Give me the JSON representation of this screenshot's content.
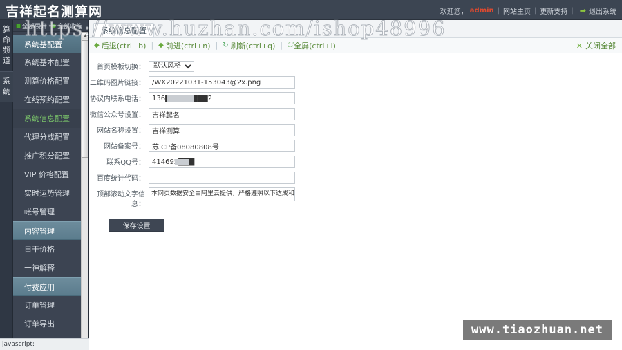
{
  "topbar": {
    "logo": "吉祥起名测算网",
    "welcome": "欢迎您，",
    "user": "admin",
    "sep1": "|",
    "home": "网站主页",
    "sep2": "|",
    "update": "更新支持",
    "sep3": "|",
    "arrow_icon": "➡",
    "logout": "退出系统"
  },
  "vtabs": [
    {
      "label": "算命频道",
      "chars": [
        "算",
        "命",
        "频",
        "道"
      ]
    },
    {
      "label": "系统",
      "chars": [
        "系",
        "统"
      ]
    }
  ],
  "sidebar": {
    "tools": {
      "expand_all": "全部展开",
      "collapse_all": "全部收缩"
    },
    "items": [
      {
        "label": "系统基配置",
        "type": "group",
        "selected": false
      },
      {
        "label": "系统基本配置",
        "type": "item",
        "selected": false
      },
      {
        "label": "测算价格配置",
        "type": "item",
        "selected": false
      },
      {
        "label": "在线预约配置",
        "type": "item",
        "selected": false
      },
      {
        "label": "系统信息配置",
        "type": "item",
        "selected": true
      },
      {
        "label": "代理分成配置",
        "type": "item",
        "selected": false
      },
      {
        "label": "推广积分配置",
        "type": "item",
        "selected": false
      },
      {
        "label": "VIP 价格配置",
        "type": "item",
        "selected": false
      },
      {
        "label": "实时运势管理",
        "type": "item",
        "selected": false
      },
      {
        "label": "帐号管理",
        "type": "item",
        "selected": false
      },
      {
        "label": "内容管理",
        "type": "group",
        "selected": false
      },
      {
        "label": "日干价格",
        "type": "item",
        "selected": false
      },
      {
        "label": "十神解释",
        "type": "item",
        "selected": false
      },
      {
        "label": "付费应用",
        "type": "group",
        "selected": false
      },
      {
        "label": "订单管理",
        "type": "item",
        "selected": false
      },
      {
        "label": "订单导出",
        "type": "item",
        "selected": false
      }
    ]
  },
  "main": {
    "tab": {
      "label": "系统信息配置"
    },
    "nav": {
      "back": "后退(ctrl+b)",
      "forward": "前进(ctrl+n)",
      "refresh": "刷新(ctrl+q)",
      "fullscreen": "全屏(ctrl+i)",
      "close_all": "关闭全部",
      "back_icon": "◆",
      "forward_icon": "◆",
      "refresh_icon": "↻",
      "fullscreen_icon": "⛶",
      "close_icon": "✕",
      "sep": "|"
    }
  },
  "form": {
    "fields": [
      {
        "label": "首页模板切换：",
        "type": "select",
        "value": "默认风格",
        "options": [
          "默认风格"
        ]
      },
      {
        "label": "二维码图片链接：",
        "type": "text",
        "value": "/WX20221031-153043@2x.png"
      },
      {
        "label": "协议内联系电话：",
        "type": "text",
        "value": "136████████2",
        "masked": true
      },
      {
        "label": "微信公众号设置：",
        "type": "text",
        "value": "吉祥起名"
      },
      {
        "label": "网站名称设置：",
        "type": "text",
        "value": "吉祥测算"
      },
      {
        "label": "网站备案号：",
        "type": "text",
        "value": "苏ICP备08080808号"
      },
      {
        "label": "联系QQ号：",
        "type": "text",
        "value": "414695███",
        "masked": true
      },
      {
        "label": "百度统计代码：",
        "type": "text",
        "value": ""
      },
      {
        "label": "顶部滚动文字信息：",
        "type": "textarea",
        "value": "本网页数据安全由阿里云提供，严格遵照以下达成和用户协议对您"
      }
    ],
    "save_button": "保存设置"
  },
  "statusbar": {
    "text": "javascript:"
  },
  "watermarks": {
    "top": "https://www.huzhan.com/ishop48996",
    "bottom": "www.tiaozhuan.net"
  },
  "colors": {
    "topbar_bg": "#3c4552",
    "sidebar_bg": "#3c4452",
    "accent_green": "#5b8c3c",
    "user_red": "#e04a2f",
    "group_blue": "#6d8c9c",
    "selected_green": "#7ac36a"
  }
}
